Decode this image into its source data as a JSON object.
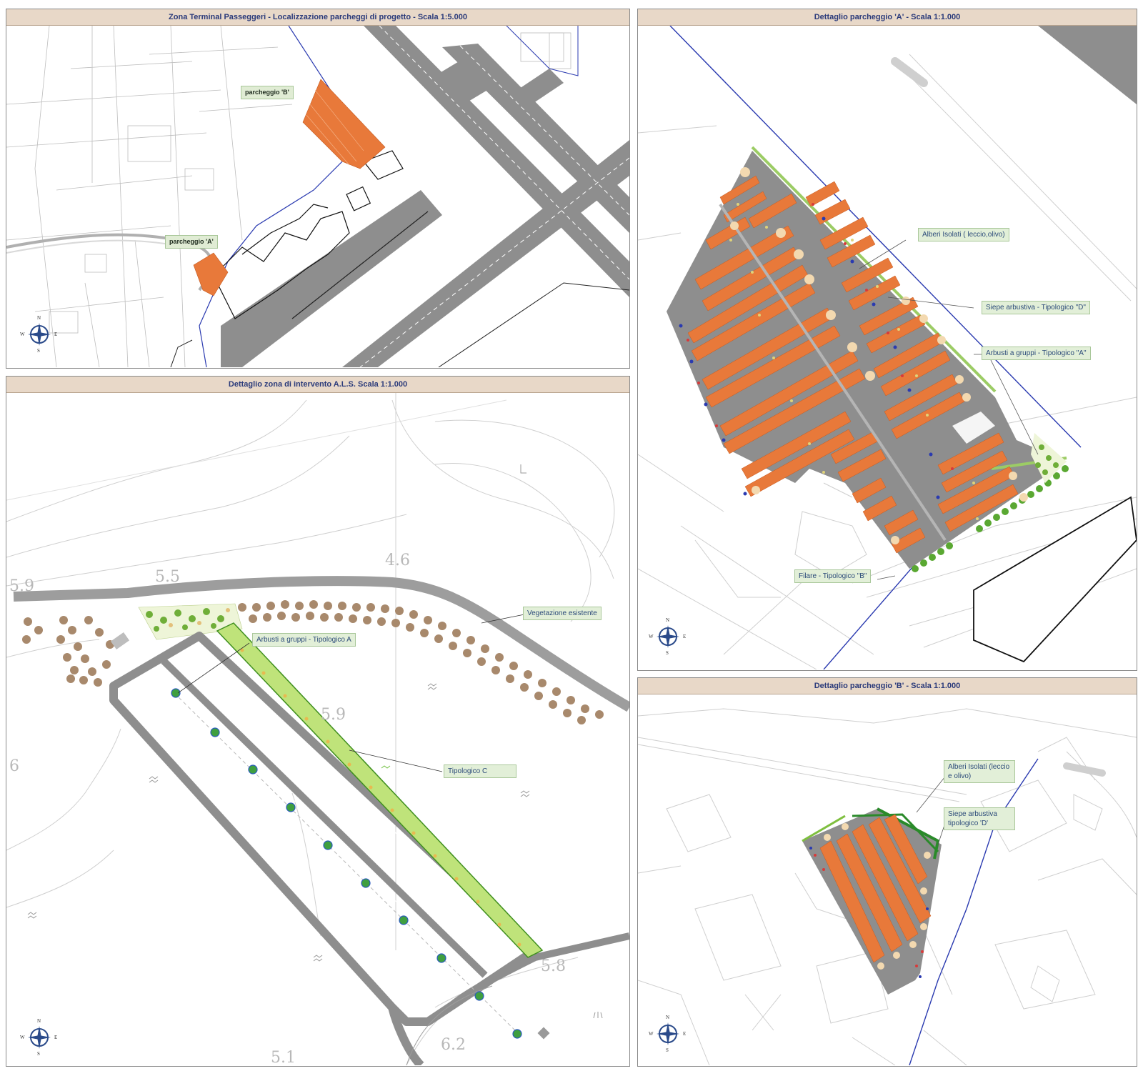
{
  "panels": {
    "terminal": {
      "title": "Zona Terminal Passeggeri - Localizzazione parcheggi di progetto -   Scala 1:5.000"
    },
    "als": {
      "title": "Dettaglio zona di intervento A.L.S.  Scala 1:1.000"
    },
    "park_a": {
      "title": "Dettaglio  parcheggio 'A' -   Scala 1:1.000"
    },
    "park_b": {
      "title": "Dettaglio  parcheggio 'B' -   Scala 1:1.000"
    }
  },
  "labels": {
    "parcheggio_b": "parcheggio 'B'",
    "parcheggio_a": "parcheggio 'A'",
    "vegetazione": "Vegetazione esistente",
    "arbusti_a": "Arbusti a gruppi - Tipologico A",
    "tipologico_c": "Tipologico C",
    "alberi_isolati_a": "Alberi Isolati ( leccio,olivo)",
    "siepe_d_a": "Siepe arbustiva - Tipologico \"D\"",
    "arbusti_gruppi_a": "Arbusti a gruppi - Tipologico \"A\"",
    "filare_b": "Filare - Tipologico \"B\"",
    "alberi_isolati_b": "Alberi Isolati (leccio e olivo)",
    "siepe_d_b": "Siepe arbustiva tipologico 'D'"
  },
  "elevations": {
    "e59": "5.9",
    "e55": "5.5",
    "e46": "4.6",
    "e59b": "5.9",
    "e6": "6",
    "e58": "5.8",
    "e62": "6.2",
    "e51": "5.1"
  },
  "compass": {
    "n": "N",
    "s": "S",
    "e": "E",
    "w": "W"
  },
  "colors": {
    "header_bg": "#e8d8c8",
    "header_text": "#2a3a7a",
    "parking_orange": "#e8793a",
    "asphalt": "#8e8e8e",
    "green": "#7fbf3f",
    "boundary_blue": "#2a3ab0"
  }
}
